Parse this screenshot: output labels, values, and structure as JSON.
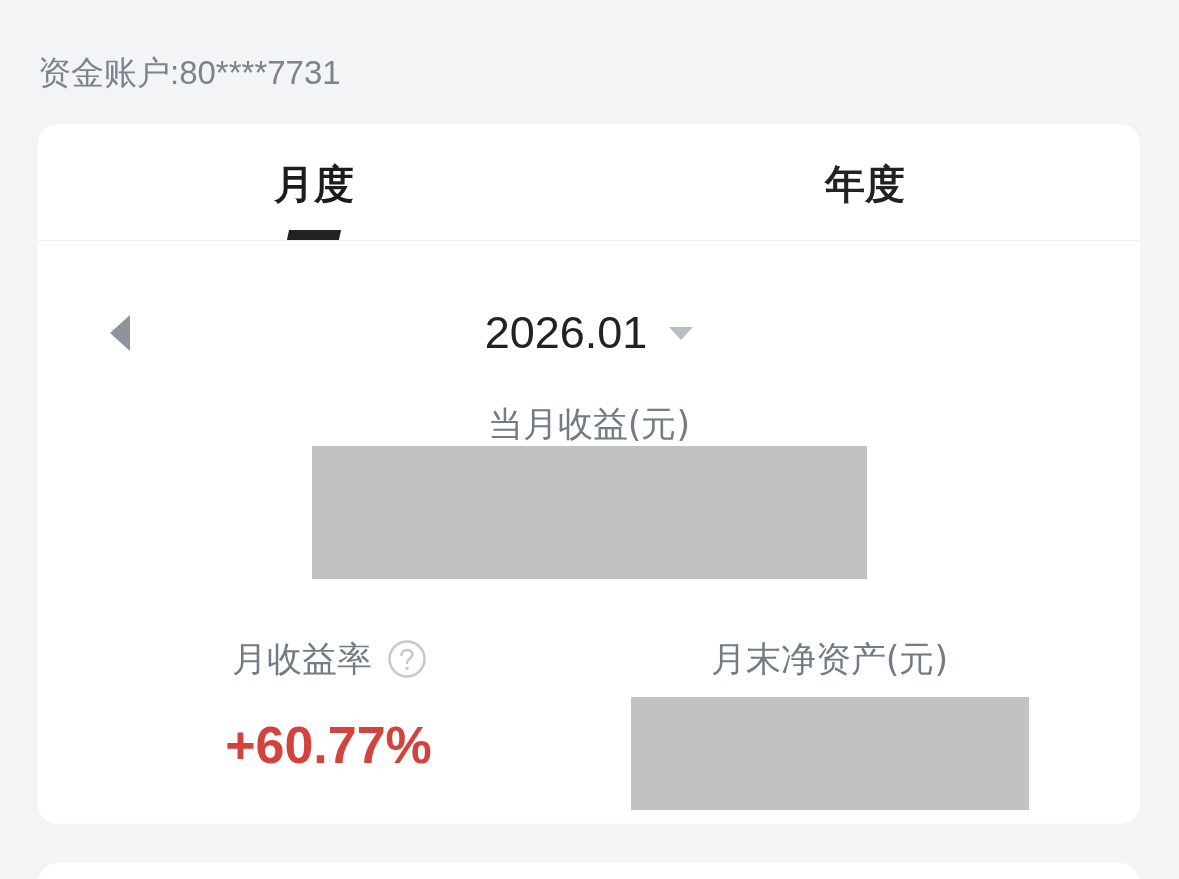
{
  "account": {
    "label": "资金账户:80****7731"
  },
  "tabs": [
    {
      "label": "月度",
      "selected": true
    },
    {
      "label": "年度",
      "selected": false
    }
  ],
  "period": {
    "value": "2026.01"
  },
  "monthly_profit": {
    "label": "当月收益(元)",
    "redacted": true
  },
  "stats": [
    {
      "label": "月收益率",
      "help": true,
      "value": "+60.77%",
      "redacted": false
    },
    {
      "label": "月末净资产(元)",
      "help": false,
      "redacted": true
    }
  ]
}
